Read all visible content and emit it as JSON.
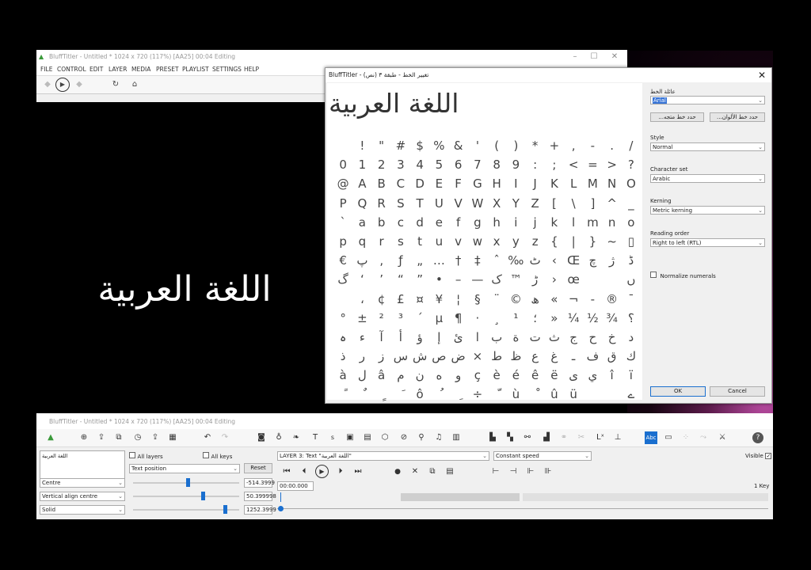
{
  "top_window": {
    "title": "BluffTitler - Untitled * 1024 x 720 (117%) [AA25] 00:04 Editing",
    "menu": [
      "FILE",
      "CONTROL",
      "EDIT",
      "LAYER",
      "MEDIA",
      "PRESET",
      "PLAYLIST",
      "SETTINGS",
      "HELP"
    ],
    "window_controls": [
      "–",
      "☐",
      "✕"
    ]
  },
  "preview": {
    "text": "اللغة العربية"
  },
  "font_dialog": {
    "title": "BluffTitler - تغيير الخط - طبقة ٣ (نص)",
    "sample_text": "اللغة العربية",
    "font_family_label": "عائلة الخط",
    "font_family_value": "Arial",
    "choose_gradient_btn": "...حدد خط متجه",
    "choose_color_btn": "...حدد خط الألوان",
    "style_label": "Style",
    "style_value": "Normal",
    "charset_label": "Character set",
    "charset_value": "Arabic",
    "kerning_label": "Kerning",
    "kerning_value": "Metric kerning",
    "reading_order_label": "Reading order",
    "reading_order_value": "Right to left (RTL)",
    "normalize_label": "Normalize numerals",
    "ok": "OK",
    "cancel": "Cancel",
    "char_rows": [
      [
        " ",
        "!",
        "\"",
        "#",
        "$",
        "%",
        "&",
        "'",
        "(",
        ")",
        "*",
        "+",
        ",",
        "-",
        ".",
        "/"
      ],
      [
        "0",
        "1",
        "2",
        "3",
        "4",
        "5",
        "6",
        "7",
        "8",
        "9",
        ":",
        ";",
        "<",
        "=",
        ">",
        "?"
      ],
      [
        "@",
        "A",
        "B",
        "C",
        "D",
        "E",
        "F",
        "G",
        "H",
        "I",
        "J",
        "K",
        "L",
        "M",
        "N",
        "O"
      ],
      [
        "P",
        "Q",
        "R",
        "S",
        "T",
        "U",
        "V",
        "W",
        "X",
        "Y",
        "Z",
        "[",
        "\\",
        "]",
        "^",
        "_"
      ],
      [
        "`",
        "a",
        "b",
        "c",
        "d",
        "e",
        "f",
        "g",
        "h",
        "i",
        "j",
        "k",
        "l",
        "m",
        "n",
        "o"
      ],
      [
        "p",
        "q",
        "r",
        "s",
        "t",
        "u",
        "v",
        "w",
        "x",
        "y",
        "z",
        "{",
        "|",
        "}",
        "~",
        "▯"
      ],
      [
        "€",
        "پ",
        "‚",
        "ƒ",
        "„",
        "…",
        "†",
        "‡",
        "ˆ",
        "‰",
        "ٹ",
        "‹",
        "Œ",
        "چ",
        "ژ",
        "ڈ"
      ],
      [
        "گ",
        "‘",
        "’",
        "“",
        "”",
        "•",
        "–",
        "—",
        "ک",
        "™",
        "ڑ",
        "›",
        "œ",
        " ",
        " ",
        "ں"
      ],
      [
        " ",
        "،",
        "¢",
        "£",
        "¤",
        "¥",
        "¦",
        "§",
        "¨",
        "©",
        "ھ",
        "«",
        "¬",
        "-",
        "®",
        "¯"
      ],
      [
        "°",
        "±",
        "²",
        "³",
        "´",
        "µ",
        "¶",
        "·",
        "¸",
        "¹",
        "؛",
        "»",
        "¼",
        "½",
        "¾",
        "؟"
      ],
      [
        "ہ",
        "ء",
        "آ",
        "أ",
        "ؤ",
        "إ",
        "ئ",
        "ا",
        "ب",
        "ة",
        "ت",
        "ث",
        "ج",
        "ح",
        "خ",
        "د"
      ],
      [
        "ذ",
        "ر",
        "ز",
        "س",
        "ش",
        "ص",
        "ض",
        "×",
        "ط",
        "ظ",
        "ع",
        "غ",
        "ـ",
        "ف",
        "ق",
        "ك"
      ],
      [
        "à",
        "ل",
        "â",
        "م",
        "ن",
        "ه",
        "و",
        "ç",
        "è",
        "é",
        "ê",
        "ë",
        "ى",
        "ي",
        "î",
        "ï"
      ],
      [
        "ً",
        "ٌ",
        "ٍ",
        "َ",
        "ô",
        "ُ",
        "ِ",
        "÷",
        "ّ",
        "ù",
        "ْ",
        "û",
        "ü",
        " ",
        " ",
        "ے"
      ]
    ]
  },
  "bottom_window": {
    "title": "BluffTitler - Untitled * 1024 x 720 (117%) [AA25] 00:04 Editing",
    "layer_list_item": "اللغة العربية",
    "all_layers": "All layers",
    "all_keys": "All keys",
    "property": "Text position",
    "reset": "Reset",
    "layer_select": "LAYER 3: Text \"اللغة العربية\"",
    "speed_select": "Constant speed",
    "visible_label": "Visible",
    "align_h": "Centre",
    "align_v": "Vertical align centre",
    "fill": "Solid",
    "value_x": "-514.3999",
    "value_y": "50.399998",
    "value_z": "1252.3999",
    "time": "00:00.000",
    "keys_count": "1 Key",
    "slider_positions": [
      0.52,
      0.67,
      0.88
    ]
  },
  "colors": {
    "accent": "#1a6fcf",
    "glow": "#c04fa8"
  }
}
